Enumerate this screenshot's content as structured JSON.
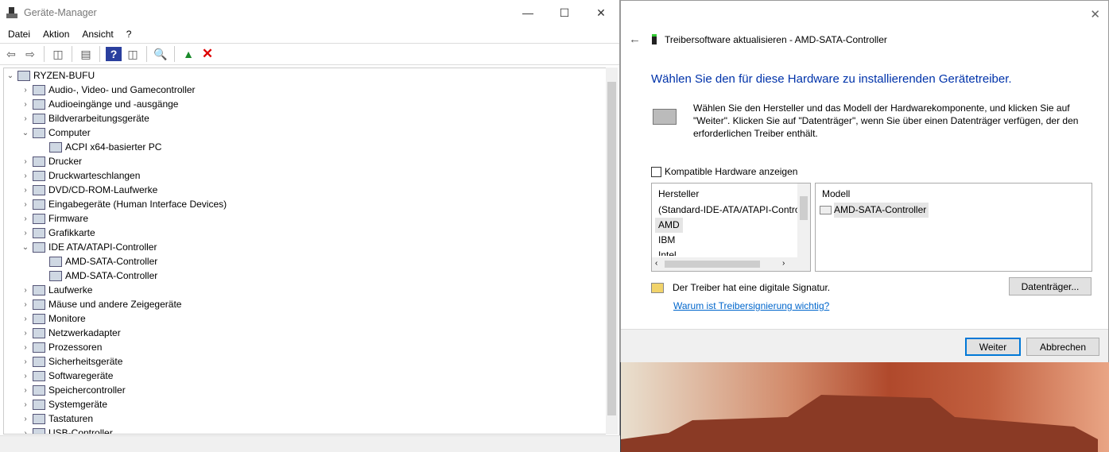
{
  "device_manager": {
    "title": "Geräte-Manager",
    "menu": [
      "Datei",
      "Aktion",
      "Ansicht",
      "?"
    ],
    "tree": [
      {
        "label": "RYZEN-BUFU",
        "level": 0,
        "expander": "expanded"
      },
      {
        "label": "Audio-, Video- und Gamecontroller",
        "level": 1,
        "expander": "collapsed"
      },
      {
        "label": "Audioeingänge und -ausgänge",
        "level": 1,
        "expander": "collapsed"
      },
      {
        "label": "Bildverarbeitungsgeräte",
        "level": 1,
        "expander": "collapsed"
      },
      {
        "label": "Computer",
        "level": 1,
        "expander": "expanded"
      },
      {
        "label": "ACPI x64-basierter PC",
        "level": 2,
        "expander": ""
      },
      {
        "label": "Drucker",
        "level": 1,
        "expander": "collapsed"
      },
      {
        "label": "Druckwarteschlangen",
        "level": 1,
        "expander": "collapsed"
      },
      {
        "label": "DVD/CD-ROM-Laufwerke",
        "level": 1,
        "expander": "collapsed"
      },
      {
        "label": "Eingabegeräte (Human Interface Devices)",
        "level": 1,
        "expander": "collapsed"
      },
      {
        "label": "Firmware",
        "level": 1,
        "expander": "collapsed"
      },
      {
        "label": "Grafikkarte",
        "level": 1,
        "expander": "collapsed"
      },
      {
        "label": "IDE ATA/ATAPI-Controller",
        "level": 1,
        "expander": "expanded"
      },
      {
        "label": "AMD-SATA-Controller",
        "level": 2,
        "expander": ""
      },
      {
        "label": "AMD-SATA-Controller",
        "level": 2,
        "expander": ""
      },
      {
        "label": "Laufwerke",
        "level": 1,
        "expander": "collapsed"
      },
      {
        "label": "Mäuse und andere Zeigegeräte",
        "level": 1,
        "expander": "collapsed"
      },
      {
        "label": "Monitore",
        "level": 1,
        "expander": "collapsed"
      },
      {
        "label": "Netzwerkadapter",
        "level": 1,
        "expander": "collapsed"
      },
      {
        "label": "Prozessoren",
        "level": 1,
        "expander": "collapsed"
      },
      {
        "label": "Sicherheitsgeräte",
        "level": 1,
        "expander": "collapsed"
      },
      {
        "label": "Softwaregeräte",
        "level": 1,
        "expander": "collapsed"
      },
      {
        "label": "Speichercontroller",
        "level": 1,
        "expander": "collapsed"
      },
      {
        "label": "Systemgeräte",
        "level": 1,
        "expander": "collapsed"
      },
      {
        "label": "Tastaturen",
        "level": 1,
        "expander": "collapsed"
      },
      {
        "label": "USB-Controller",
        "level": 1,
        "expander": "collapsed"
      }
    ]
  },
  "dialog": {
    "title": "Treibersoftware aktualisieren - AMD-SATA-Controller",
    "heading": "Wählen Sie den für diese Hardware zu installierenden Gerätetreiber.",
    "description": "Wählen Sie den Hersteller und das Modell der Hardwarekomponente, und klicken Sie auf \"Weiter\". Klicken Sie auf \"Datenträger\", wenn Sie über einen Datenträger verfügen, der den erforderlichen Treiber enthält.",
    "compatible_label": "Kompatible Hardware anzeigen",
    "compatible_checked": false,
    "manufacturer_header": "Hersteller",
    "manufacturers": [
      "(Standard-IDE-ATA/ATAPI-Controller)",
      "AMD",
      "IBM",
      "Intel"
    ],
    "manufacturer_selected": "AMD",
    "model_header": "Modell",
    "models": [
      "AMD-SATA-Controller"
    ],
    "signature_text": "Der Treiber hat eine digitale Signatur.",
    "signature_link": "Warum ist Treibersignierung wichtig?",
    "disk_button": "Datenträger...",
    "next_button": "Weiter",
    "cancel_button": "Abbrechen"
  },
  "colors": {
    "heading": "#0033aa",
    "link": "#0066cc",
    "focus": "#0078d7"
  }
}
